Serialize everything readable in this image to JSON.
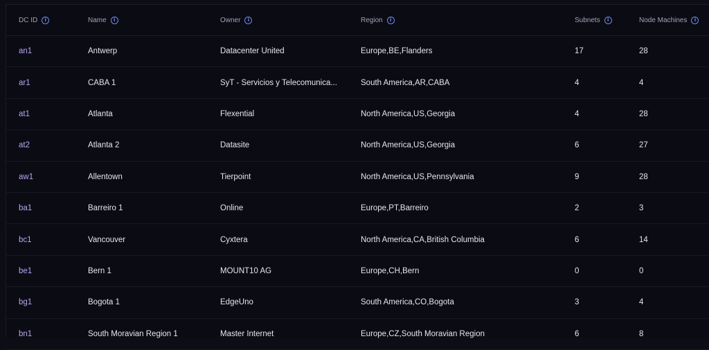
{
  "table": {
    "headers": {
      "dc_id": "DC ID",
      "name": "Name",
      "owner": "Owner",
      "region": "Region",
      "subnets": "Subnets",
      "node_machines": "Node Machines"
    },
    "rows": [
      {
        "dc_id": "an1",
        "name": "Antwerp",
        "owner": "Datacenter United",
        "region": "Europe,BE,Flanders",
        "subnets": "17",
        "node_machines": "28"
      },
      {
        "dc_id": "ar1",
        "name": "CABA 1",
        "owner": "SyT - Servicios y Telecomunica...",
        "region": "South America,AR,CABA",
        "subnets": "4",
        "node_machines": "4"
      },
      {
        "dc_id": "at1",
        "name": "Atlanta",
        "owner": "Flexential",
        "region": "North America,US,Georgia",
        "subnets": "4",
        "node_machines": "28"
      },
      {
        "dc_id": "at2",
        "name": "Atlanta 2",
        "owner": "Datasite",
        "region": "North America,US,Georgia",
        "subnets": "6",
        "node_machines": "27"
      },
      {
        "dc_id": "aw1",
        "name": "Allentown",
        "owner": "Tierpoint",
        "region": "North America,US,Pennsylvania",
        "subnets": "9",
        "node_machines": "28"
      },
      {
        "dc_id": "ba1",
        "name": "Barreiro 1",
        "owner": "Online",
        "region": "Europe,PT,Barreiro",
        "subnets": "2",
        "node_machines": "3"
      },
      {
        "dc_id": "bc1",
        "name": "Vancouver",
        "owner": "Cyxtera",
        "region": "North America,CA,British Columbia",
        "subnets": "6",
        "node_machines": "14"
      },
      {
        "dc_id": "be1",
        "name": "Bern 1",
        "owner": "MOUNT10 AG",
        "region": "Europe,CH,Bern",
        "subnets": "0",
        "node_machines": "0"
      },
      {
        "dc_id": "bg1",
        "name": "Bogota 1",
        "owner": "EdgeUno",
        "region": "South America,CO,Bogota",
        "subnets": "3",
        "node_machines": "4"
      },
      {
        "dc_id": "bn1",
        "name": "South Moravian Region 1",
        "owner": "Master Internet",
        "region": "Europe,CZ,South Moravian Region",
        "subnets": "6",
        "node_machines": "8"
      }
    ]
  },
  "icons": {
    "header_info": "info-circle-icon"
  },
  "colors": {
    "background": "#0b0b14",
    "id_text": "#b9a6ef",
    "header_text": "#a3a3b8",
    "info_icon": "#6d8cf0",
    "cell_text": "#e6e6ee"
  }
}
